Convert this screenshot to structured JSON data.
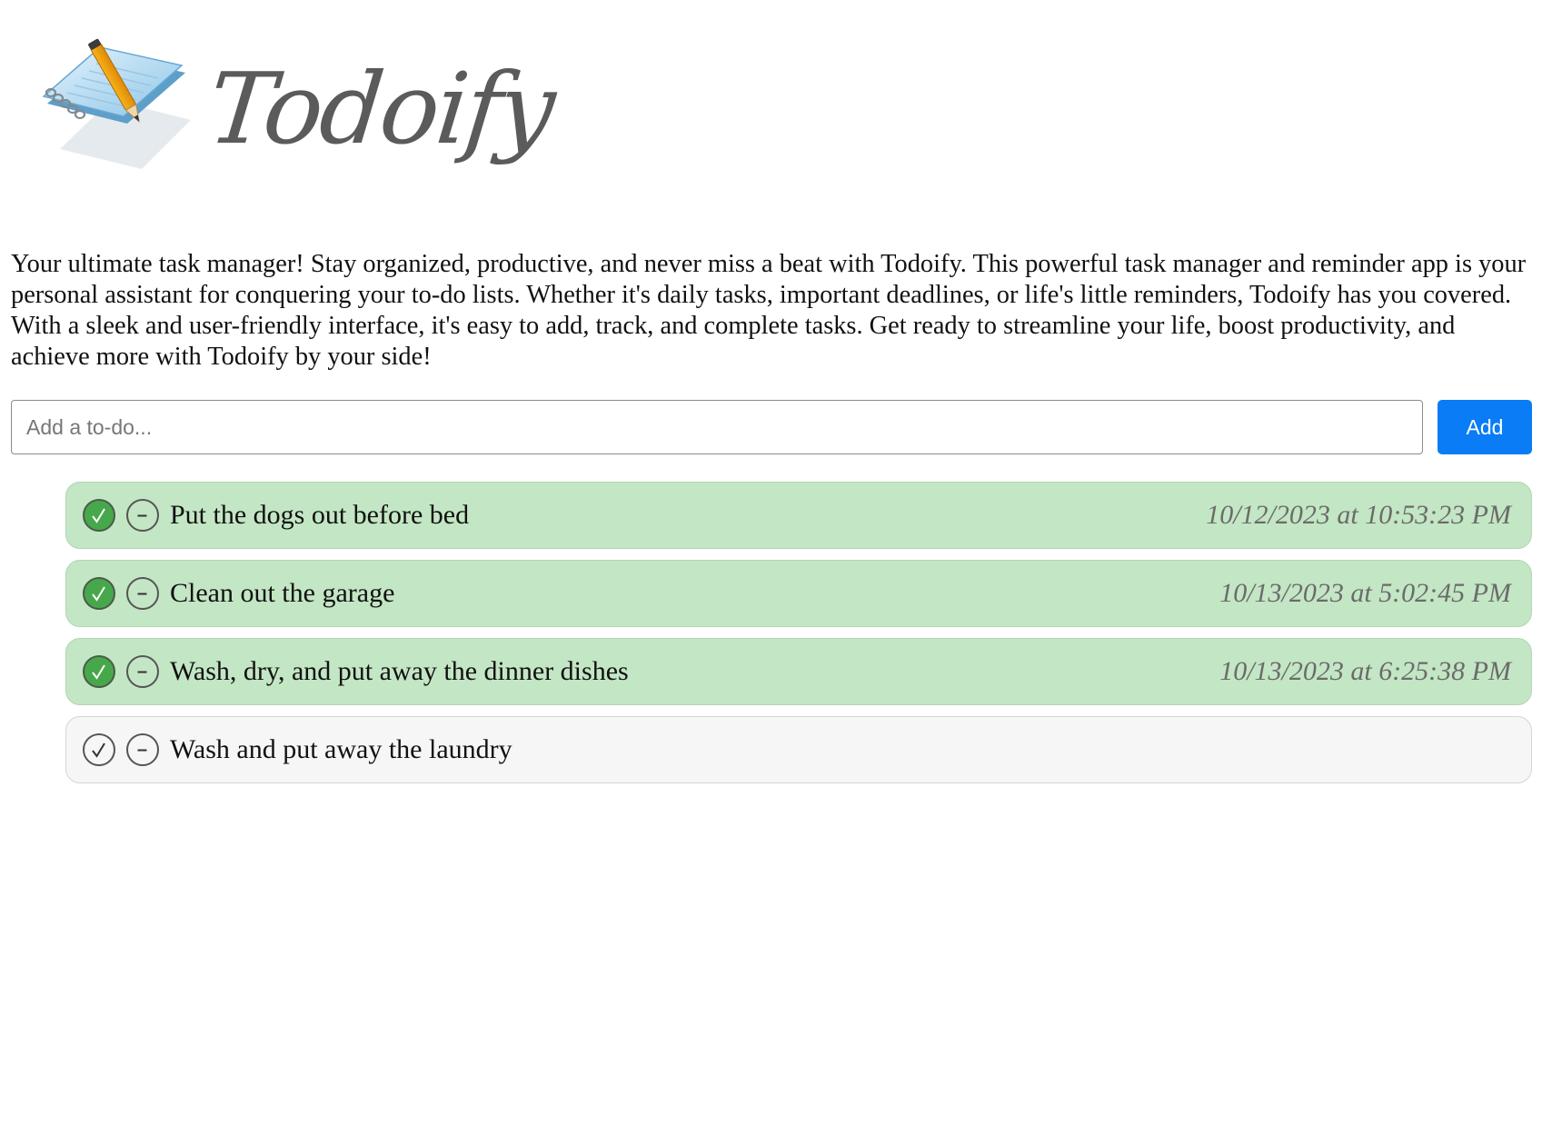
{
  "app": {
    "name": "Todoify"
  },
  "description": "Your ultimate task manager! Stay organized, productive, and never miss a beat with Todoify. This powerful task manager and reminder app is your personal assistant for conquering your to-do lists. Whether it's daily tasks, important deadlines, or life's little reminders, Todoify has you covered. With a sleek and user-friendly interface, it's easy to add, track, and complete tasks. Get ready to streamline your life, boost productivity, and achieve more with Todoify by your side!",
  "add_form": {
    "input_value": "",
    "placeholder": "Add a to-do...",
    "button_label": "Add"
  },
  "todos": [
    {
      "text": "Put the dogs out before bed",
      "completed": true,
      "completed_at": "10/12/2023 at 10:53:23 PM"
    },
    {
      "text": "Clean out the garage",
      "completed": true,
      "completed_at": "10/13/2023 at 5:02:45 PM"
    },
    {
      "text": "Wash, dry, and put away the dinner dishes",
      "completed": true,
      "completed_at": "10/13/2023 at 6:25:38 PM"
    },
    {
      "text": "Wash and put away the laundry",
      "completed": false,
      "completed_at": ""
    }
  ],
  "icons": {
    "logo": "notepad-pencil-icon",
    "complete": "check-circle-icon",
    "remove": "minus-circle-icon"
  },
  "colors": {
    "accent": "#0a7cf5",
    "done_row": "#c3e6c4",
    "open_row": "#f6f6f6",
    "check_fill": "#47a84b"
  }
}
